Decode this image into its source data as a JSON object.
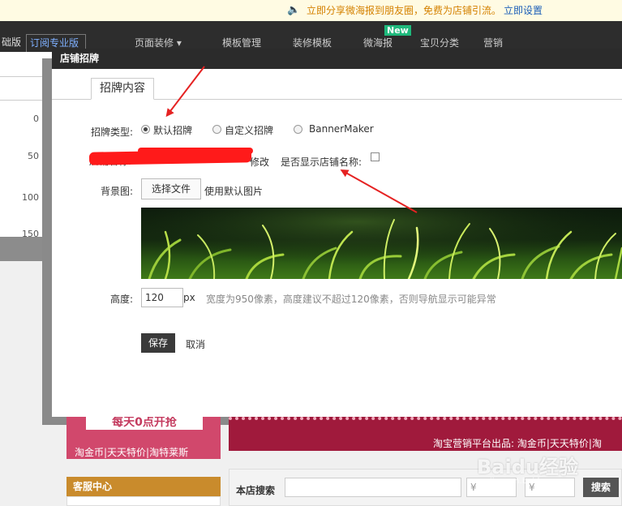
{
  "notice": {
    "message": "立即分享微海报到朋友圈，免费为店铺引流。",
    "action": "立即设置"
  },
  "topnav": {
    "version_basic": "础版",
    "version_pro": "订阅专业版",
    "items": [
      "页面装修 ▾",
      "模板管理",
      "装修模板",
      "微海报",
      "宝贝分类",
      "营销"
    ],
    "new_badge": "New"
  },
  "ruler": {
    "ticks": [
      "0",
      "50",
      "100",
      "150"
    ]
  },
  "dialog": {
    "title": "店铺招牌",
    "tab": "招牌内容",
    "type_label": "招牌类型:",
    "type_options": [
      {
        "label": "默认招牌",
        "checked": true
      },
      {
        "label": "自定义招牌",
        "checked": false
      },
      {
        "label": "BannerMaker",
        "checked": false
      }
    ],
    "shop_name_label": "店铺名称:",
    "modify_link": "修改",
    "show_name_label": "是否显示店铺名称:",
    "show_name_checked": false,
    "bg_label": "背景图:",
    "choose_file": "选择文件",
    "use_default": "使用默认图片",
    "height_label": "高度:",
    "height_value": "120",
    "height_unit": "px",
    "hint": "宽度为950像素，高度建议不超过120像素，否则导航显示可能异常",
    "save": "保存",
    "cancel": "取消"
  },
  "promo": {
    "left_button": "每天0点开抢",
    "left_sub": "淘金币|天天特价|淘特莱斯",
    "right_text": "淘宝营销平台出品: 淘金币|天天特价|淘"
  },
  "sidebar": {
    "kefu": "客服中心"
  },
  "search": {
    "label": "本店搜索",
    "price_from": "¥",
    "price_to": "¥",
    "button": "搜索"
  },
  "watermark": {
    "main": "Baidu经验",
    "sub": "jingyan.baidu.com"
  },
  "colors": {
    "accent_red": "#e52222",
    "topnav_bg": "#2d2d2d",
    "promo_pink": "#d1486c",
    "promo_maroon": "#a01a3c",
    "kefu_gold": "#c98b2c"
  }
}
